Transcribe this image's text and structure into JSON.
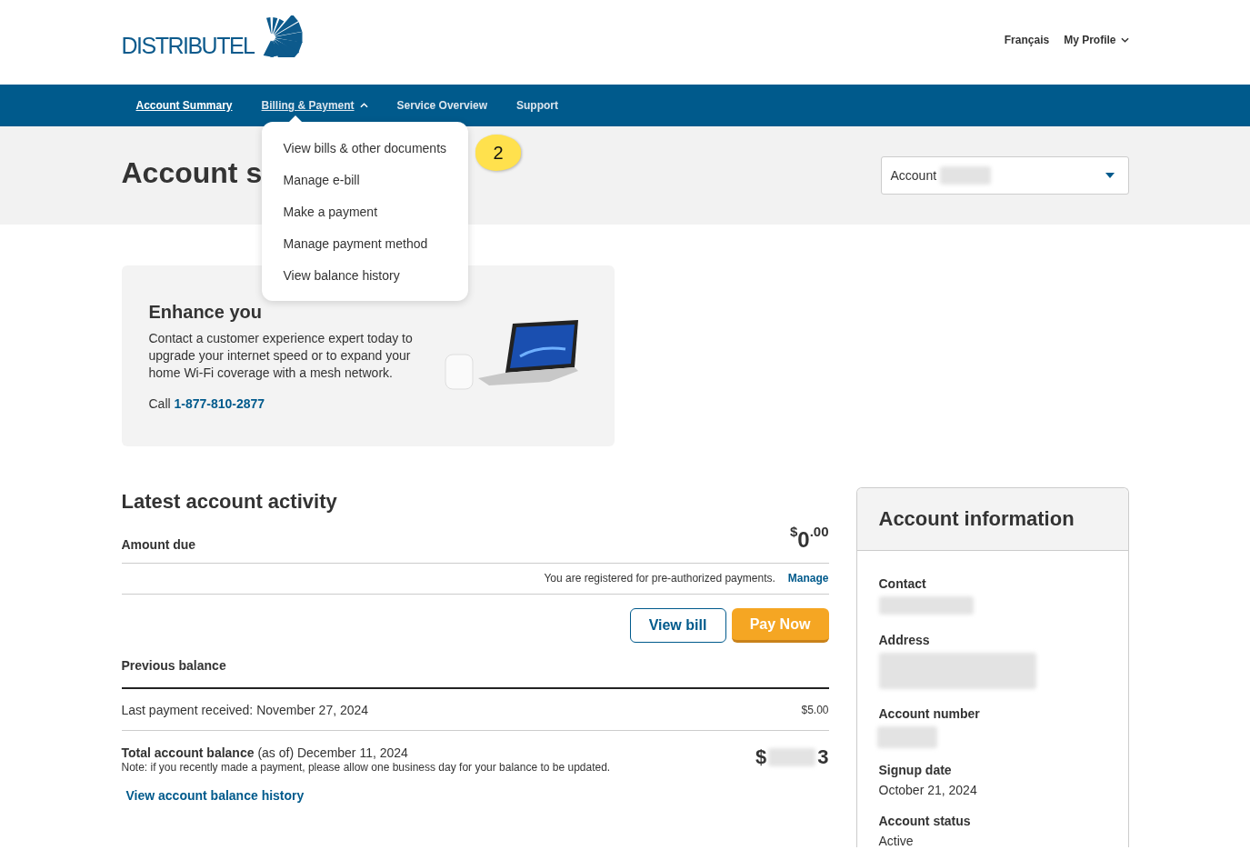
{
  "header": {
    "logo": "DISTRIBUTEL",
    "links": [
      {
        "label": "Français",
        "kind": "link"
      },
      {
        "label": "My Profile",
        "kind": "dropdown"
      }
    ]
  },
  "nav": {
    "items": [
      {
        "label": "Account Summary",
        "selected": true,
        "expanded": false
      },
      {
        "label": "Billing & Payment",
        "selected": false,
        "expanded": true
      },
      {
        "label": "Service Overview",
        "selected": false,
        "expanded": false
      },
      {
        "label": "Support",
        "selected": false,
        "expanded": false
      }
    ],
    "menu": [
      "View bills & other documents",
      "Manage e-bill",
      "Make a payment",
      "Manage payment method",
      "View balance history"
    ],
    "callout": "2"
  },
  "page_title": "Account s",
  "account_select": {
    "label": "Account"
  },
  "promo": {
    "title": "Enhance you",
    "text": "Contact a customer experience expert today to upgrade your internet speed or to expand your home Wi-Fi coverage with a mesh network.",
    "call_label": "Call",
    "phone": "1-877-810-2877"
  },
  "activity": {
    "title": "Latest account activity",
    "amount_due_label": "Amount due",
    "amount": {
      "currency": "$",
      "whole": "0",
      "cents": ".00"
    },
    "preauth_text": "You are registered for pre-authorized payments.",
    "manage_link": "Manage",
    "buttons": [
      {
        "label": "View bill",
        "kind": "secondary"
      },
      {
        "label": "Pay Now",
        "kind": "primary"
      }
    ],
    "previous_balance_label": "Previous balance",
    "last_payment": "Last payment received: November 27, 2024",
    "last_payment_amount": "$5.00",
    "total_label": "Total account balance",
    "total_date": " (as of) December 11, 2024",
    "total_currency": "$",
    "total_tail": "3",
    "note": "Note: if you recently made a payment, please allow one business day for your balance to be updated.",
    "history_link": "View account balance history"
  },
  "account_info": {
    "title": "Account information",
    "fields": [
      {
        "label": "Contact",
        "kind": "redacted"
      },
      {
        "label": "Address",
        "kind": "redacted"
      },
      {
        "label": "Account number",
        "kind": "redacted"
      },
      {
        "label": "Signup date",
        "kind": "text",
        "value": "October 21, 2024"
      },
      {
        "label": "Account status",
        "kind": "text",
        "value": "Active"
      }
    ]
  }
}
